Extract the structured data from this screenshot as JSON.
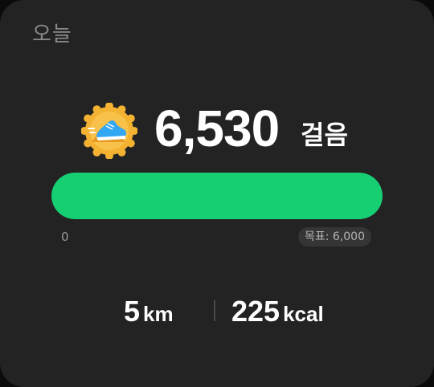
{
  "card": {
    "title": "오늘"
  },
  "steps": {
    "count": "6,530",
    "unit": "걸음",
    "badge_icon": "running-shoe-badge-icon",
    "progress_fraction": 1.0,
    "axis_min": "0",
    "goal_label": "목표: 6,000"
  },
  "stats": {
    "distance_value": "5",
    "distance_unit": "km",
    "calories_value": "225",
    "calories_unit": "kcal"
  },
  "colors": {
    "progress": "#16cf72",
    "card_bg": "#232323",
    "badge_gold": "#f2b233"
  }
}
